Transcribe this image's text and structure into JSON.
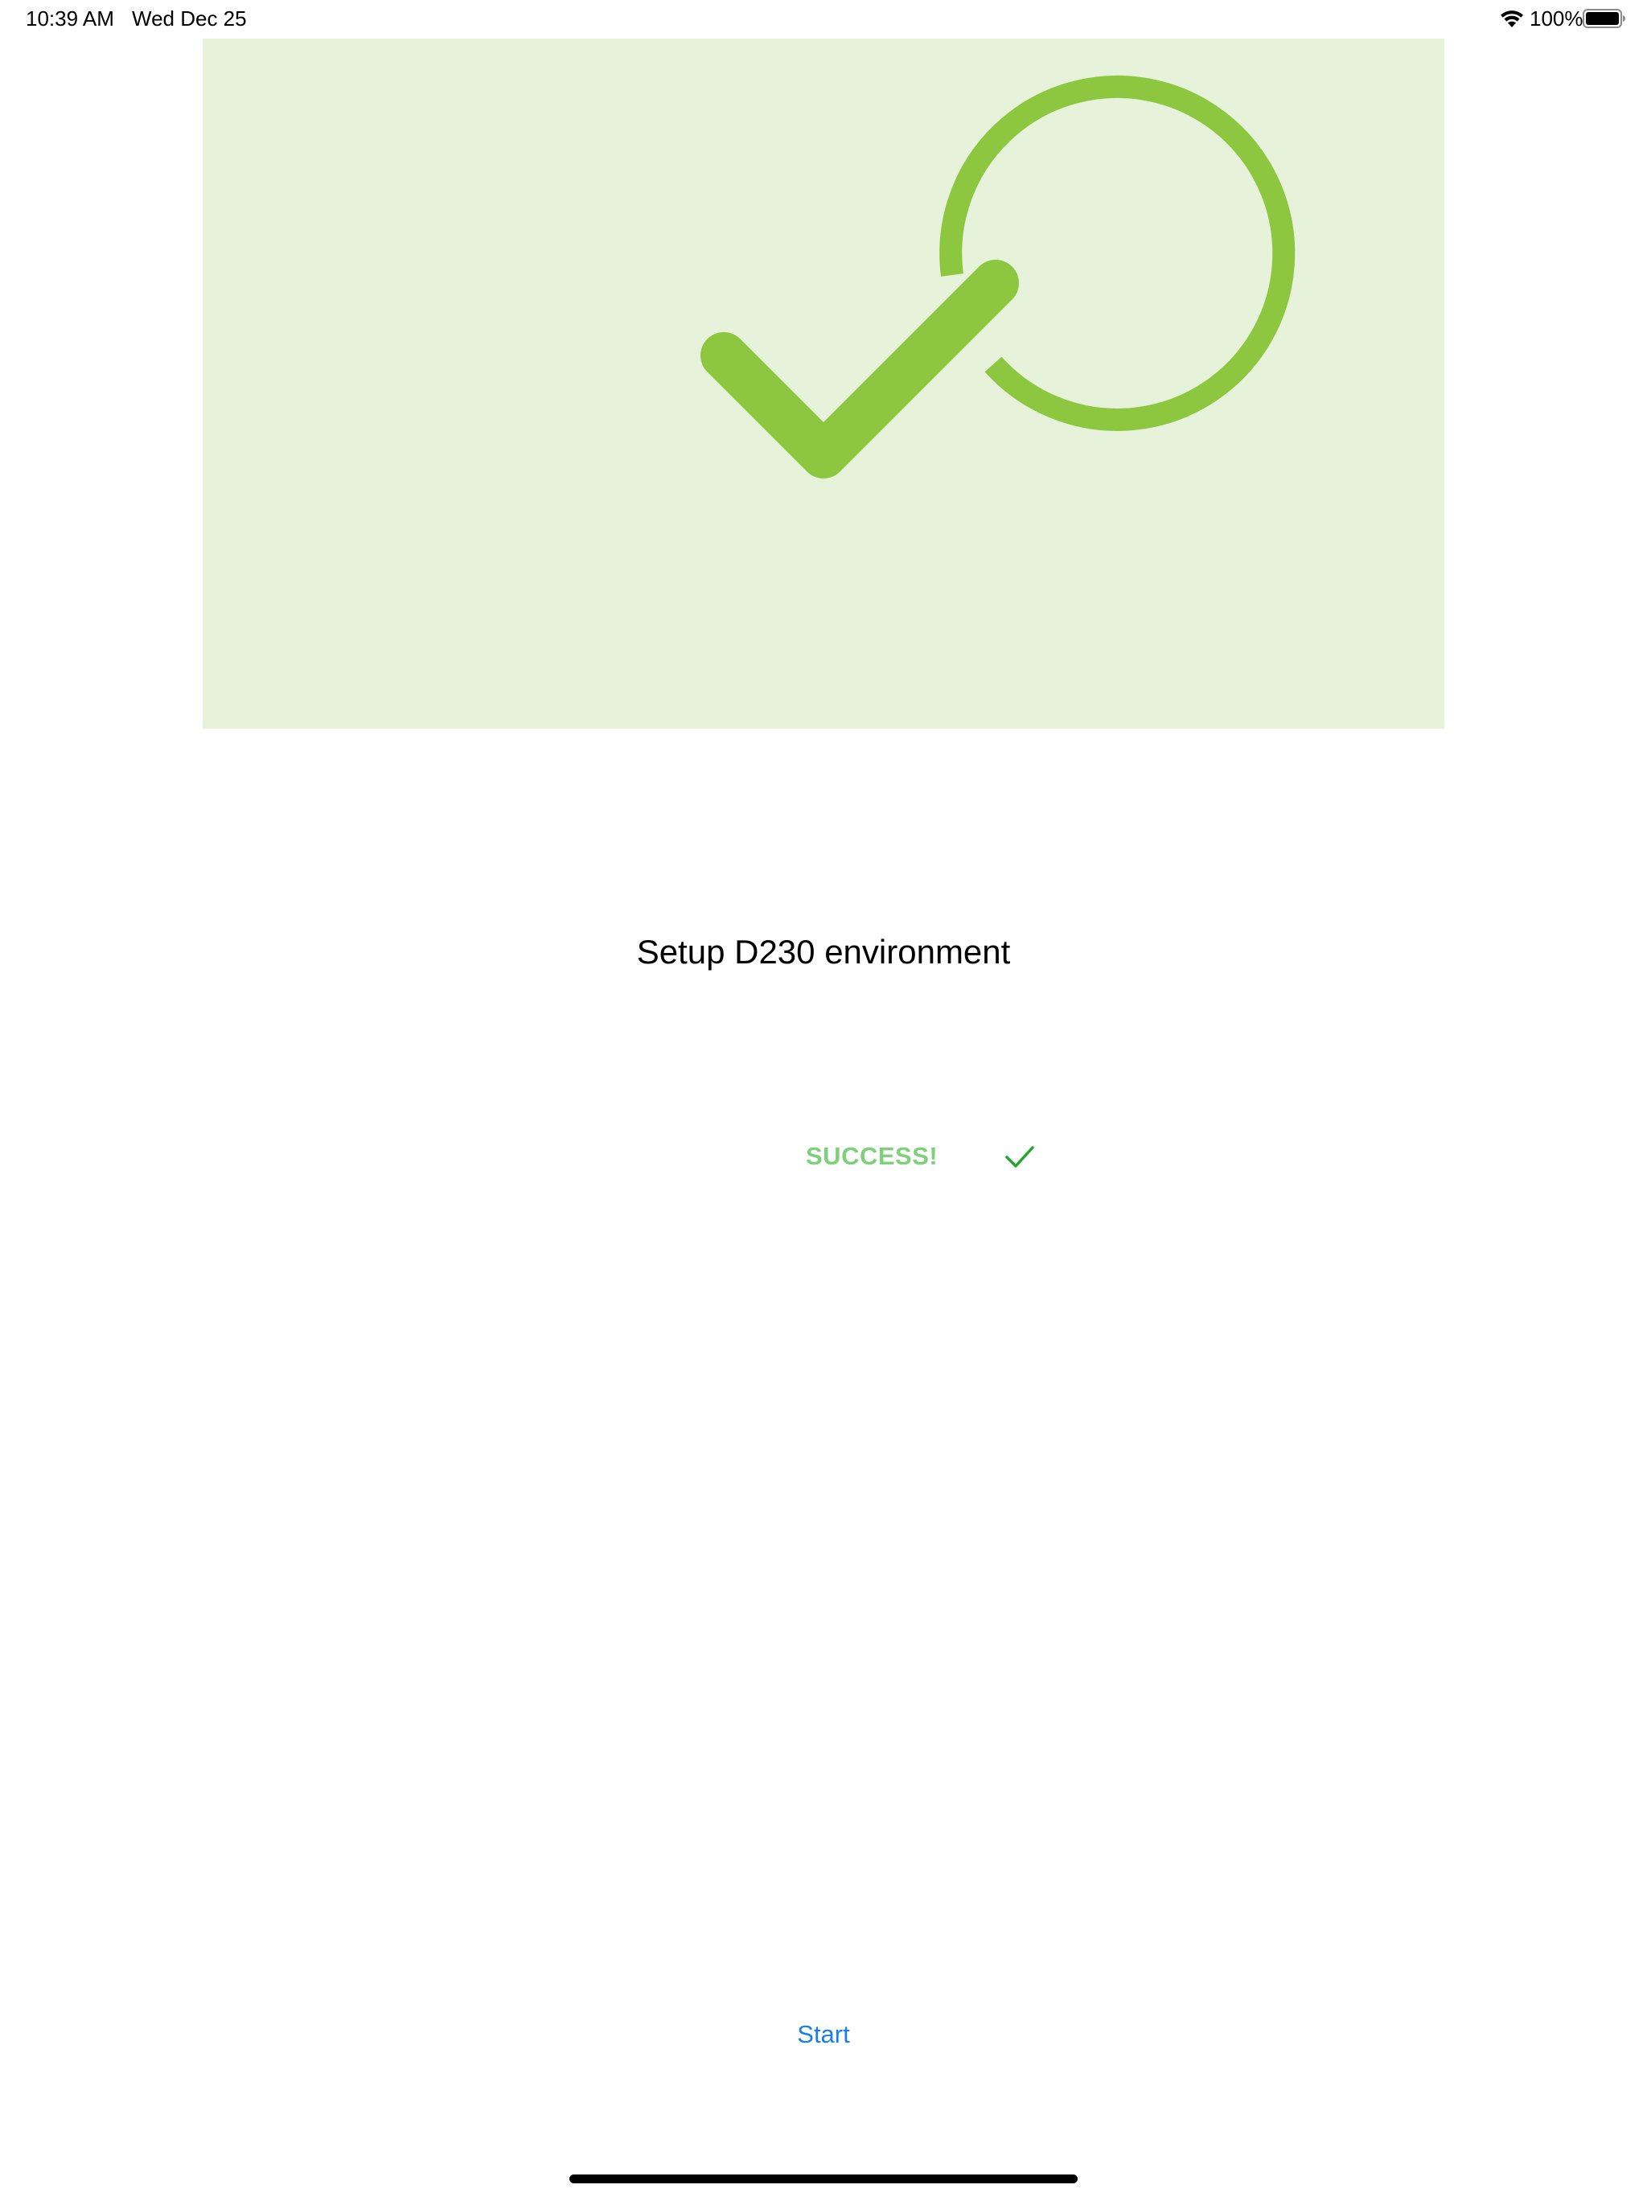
{
  "status_bar": {
    "time": "10:39 AM",
    "date": "Wed Dec 25",
    "battery_percent": "100%",
    "battery_level": 1.0,
    "wifi_icon": "wifi-icon",
    "battery_icon": "battery-icon"
  },
  "hero": {
    "icon": "check-circle-icon",
    "background_color": "#e7f2da",
    "icon_color": "#8dc63f"
  },
  "title": "Setup D230 environment",
  "status": {
    "label": "SUCCESS!",
    "icon": "checkmark-icon",
    "label_color": "#7ed07a",
    "icon_color": "#22a830"
  },
  "actions": {
    "start_label": "Start",
    "start_color": "#1a7ee8"
  }
}
